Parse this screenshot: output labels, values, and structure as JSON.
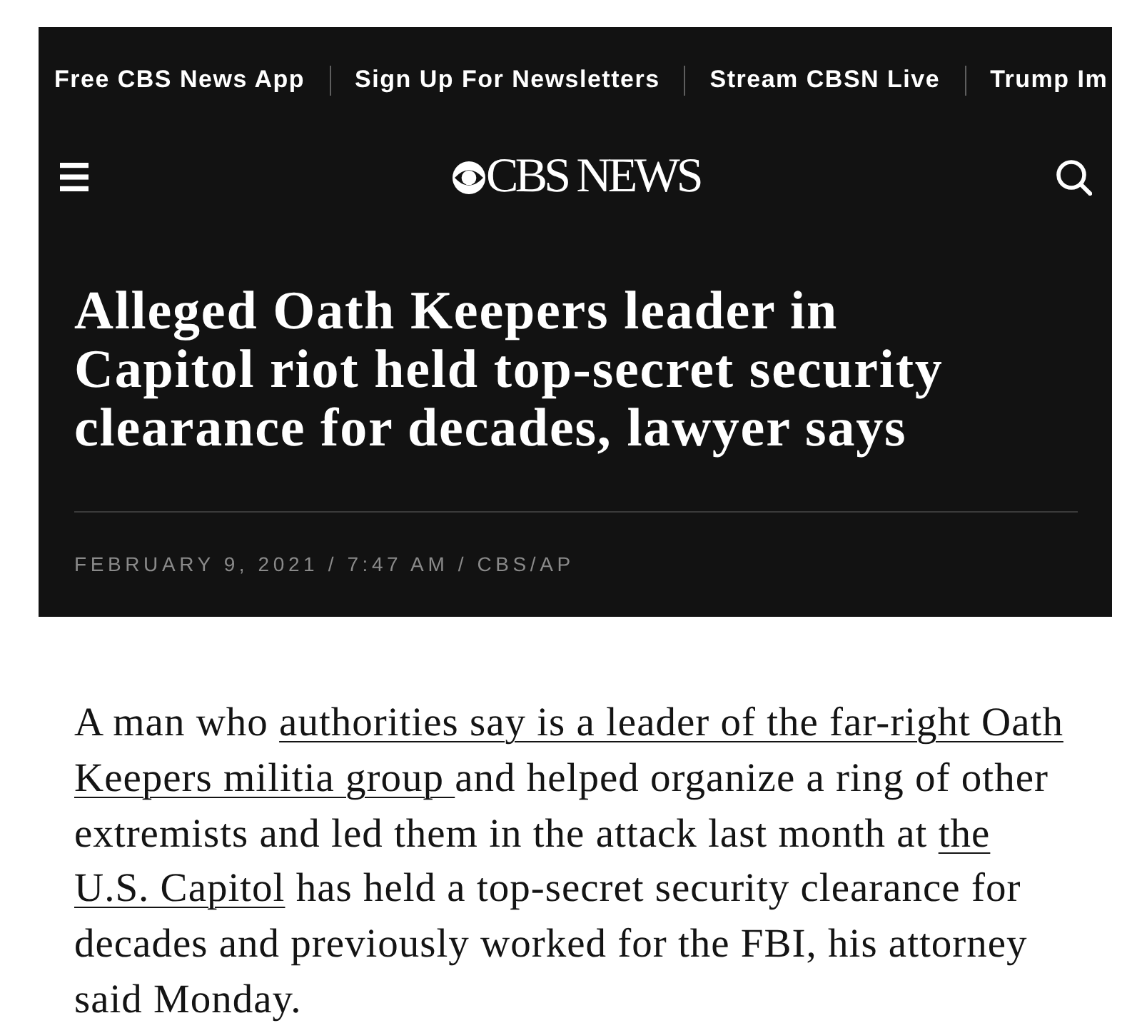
{
  "nav_links": [
    "Free CBS News App",
    "Sign Up For Newsletters",
    "Stream CBSN Live",
    "Trump Im"
  ],
  "header": {
    "logo_text": "CBS NEWS"
  },
  "headline": "Alleged Oath Keepers leader in Capitol riot held top-secret security clearance for decades, lawyer says",
  "byline": "FEBRUARY 9, 2021 / 7:47 AM / CBS/AP",
  "paragraph": {
    "segments": [
      {
        "kind": "text",
        "text": "A man who "
      },
      {
        "kind": "link",
        "text": "authorities say is a leader of the far-right Oath"
      },
      {
        "kind": "link",
        "text": "Keepers militia group "
      },
      {
        "kind": "text",
        "text": "and helped organize a ring of other extremists and led them in the attack last month at "
      },
      {
        "kind": "link",
        "text": "the"
      },
      {
        "kind": "link",
        "text": "U.S. Capitol"
      },
      {
        "kind": "text",
        "text": " has held a top-secret security clearance for decades and previously worked for the FBI, his attorney said Monday."
      }
    ]
  }
}
